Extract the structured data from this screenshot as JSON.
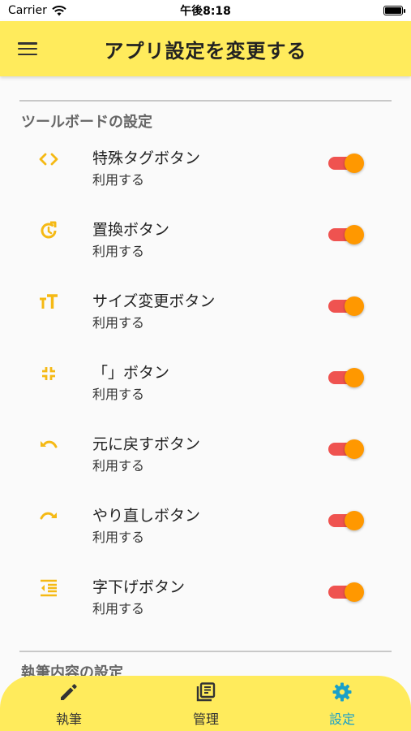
{
  "status": {
    "carrier": "Carrier",
    "time": "午後8:18"
  },
  "appbar": {
    "title": "アプリ設定を変更する",
    "menu_icon": "hamburger-menu-icon"
  },
  "toolboard": {
    "section_title": "ツールボードの設定",
    "items": [
      {
        "label": "特殊タグボタン",
        "sub": "利用する",
        "icon": "code-brackets-icon",
        "enabled": true
      },
      {
        "label": "置換ボタン",
        "sub": "利用する",
        "icon": "replace-icon",
        "enabled": true
      },
      {
        "label": "サイズ変更ボタン",
        "sub": "利用する",
        "icon": "text-size-icon",
        "enabled": true
      },
      {
        "label": "「」ボタン",
        "sub": "利用する",
        "icon": "corner-brackets-icon",
        "enabled": true
      },
      {
        "label": "元に戻すボタン",
        "sub": "利用する",
        "icon": "undo-icon",
        "enabled": true
      },
      {
        "label": "やり直しボタン",
        "sub": "利用する",
        "icon": "redo-icon",
        "enabled": true
      },
      {
        "label": "字下げボタン",
        "sub": "利用する",
        "icon": "indent-icon",
        "enabled": true
      }
    ]
  },
  "writing": {
    "section_title": "執筆内容の設定"
  },
  "bottom_nav": {
    "items": [
      {
        "label": "執筆",
        "icon": "pencil-icon",
        "active": false
      },
      {
        "label": "管理",
        "icon": "library-icon",
        "active": false
      },
      {
        "label": "設定",
        "icon": "gear-icon",
        "active": true
      }
    ]
  },
  "colors": {
    "accent": "#ffeb5c",
    "icon_yellow": "#f5b914",
    "toggle_track": "#ef5350",
    "toggle_thumb": "#ff9800",
    "nav_active": "#1aa0c8",
    "nav_inactive": "#333333"
  }
}
